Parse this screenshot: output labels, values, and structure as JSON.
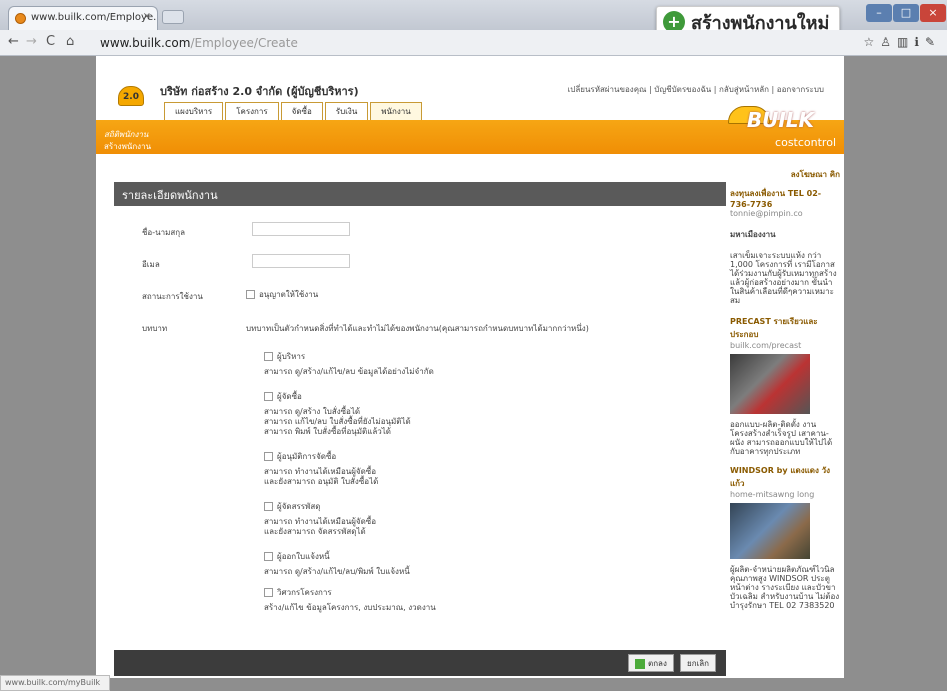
{
  "browser": {
    "tab_title": "www.builk.com/Employe...",
    "url_host": "www.builk.com",
    "url_path": "/Employee/Create",
    "status_bar": "www.builk.com/myBuilk"
  },
  "overlay": {
    "label": "สร้างพนักงานใหม่"
  },
  "header": {
    "logo_badge": "2.0",
    "company": "บริษัท ก่อสร้าง 2.0 จำกัด (ผู้บัญชีบริหาร)",
    "top_links": "เปลี่ยนรหัสผ่านของคุณ | บัญชีบัตรของฉัน | กลับสู่หน้าหลัก | ออกจากระบบ",
    "tabs": [
      "แผงบริหาร",
      "โครงการ",
      "จัดซื้อ",
      "รับเงิน",
      "พนักงาน"
    ],
    "breadcrumb_parent": "สถิติพนักงาน",
    "breadcrumb_current": "สร้างพนักงาน",
    "logo_word": "BUILK",
    "logo_sub": "costcontrol"
  },
  "form": {
    "panel_title": "รายละเอียดพนักงาน",
    "name_label": "ชื่อ-นามสกุล",
    "email_label": "อีเมล",
    "status_label": "สถานะการใช้งาน",
    "status_option": "อนุญาตให้ใช้งาน",
    "role_label": "บทบาท",
    "role_hint": "บทบาทเป็นตัวกำหนดสิ่งที่ทำได้และทำไม่ได้ของพนักงาน(คุณสามารถกำหนดบทบาทได้มากกว่าหนึ่ง)",
    "roles": [
      {
        "name": "ผู้บริหาร",
        "desc": [
          "สามารถ ดู/สร้าง/แก้ไข/ลบ ข้อมูลได้อย่างไม่จำกัด"
        ]
      },
      {
        "name": "ผู้จัดซื้อ",
        "desc": [
          "สามารถ ดู/สร้าง ใบสั่งซื้อได้",
          "สามารถ แก้ไข/ลบ ใบสั่งซื้อที่ยังไม่อนุมัติได้",
          "สามารถ พิมพ์ ใบสั่งซื้อที่อนุมัติแล้วได้"
        ]
      },
      {
        "name": "ผู้อนุมัติการจัดซื้อ",
        "desc": [
          "สามารถ ทำงานได้เหมือนผู้จัดซื้อ",
          "และยังสามารถ อนุมัติ ใบสั่งซื้อได้"
        ]
      },
      {
        "name": "ผู้จัดสรรพัสดุ",
        "desc": [
          "สามารถ ทำงานได้เหมือนผู้จัดซื้อ",
          "และยังสามารถ จัดสรรพัสดุได้"
        ]
      },
      {
        "name": "ผู้ออกใบแจ้งหนี้",
        "desc": [
          "สามารถ ดู/สร้าง/แก้ไข/ลบ/พิมพ์ ใบแจ้งหนี้"
        ]
      },
      {
        "name": "วิศวกรโครงการ",
        "desc": [
          "สร้าง/แก้ไข ข้อมูลโครงการ, งบประมาณ, งวดงาน"
        ]
      }
    ],
    "save_button": "ตกลง",
    "cancel_button": "ยกเลิก"
  },
  "sidebar": {
    "ad_label": "ลงโฆษณา คิก",
    "contact": "ลงทุนลงเพื่องาน TEL 02-736-7736",
    "contact_email": "tonnie@pimpin.co",
    "brand": "มหาเมืองงาน",
    "blurb": "เสาเข็มเจาะระบบแห้ง กว่า 1,000 โครงการที่ เรามีโอกาสได้ร่วมงานกับผู้รับเหมาทุกสร้างแล้วผู้ก่อสร้างอย่างมาก ขั้นนำในสินค้าเลือนที่ดีๆความเหมาะสม",
    "precast_title": "PRECAST รายเรียวและประกอบ",
    "precast_url": "builk.com/precast",
    "precast_desc": "ออกแบบ-ผลิต-ติดตั้ง งานโครงสร้างสำเร็จรูป เสาคาน-ผนัง สามารถออกแบบให้ไปได้กับอาคารทุกประเภท",
    "windsor_title": "WINDSOR by แดงแดง วังแก้ว",
    "windsor_sub": "home-mitsawng long",
    "windsor_desc": "ผู้ผลิต-จำหน่ายผลิตภัณฑ์ไวนิลคุณภาพสูง WINDSOR ประตู หน้าต่าง รางระเบียง และบัวขา บัวเฉลิม สำหรับงานบ้าน ไม่ต้องบำรุงรักษา TEL 02 7383520"
  }
}
